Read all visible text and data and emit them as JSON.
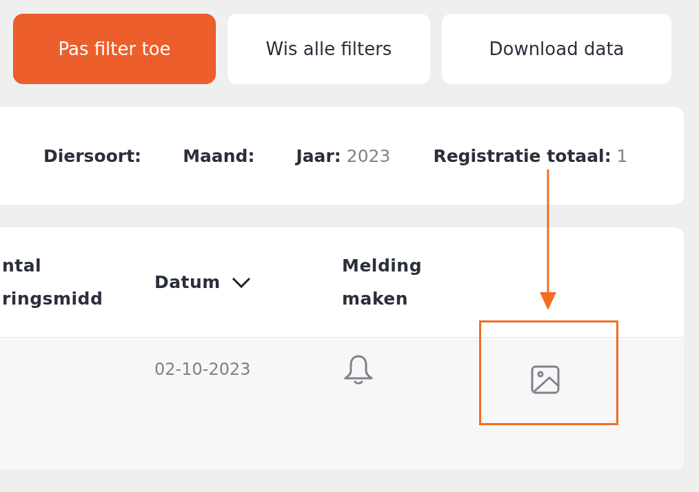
{
  "buttons": [
    {
      "label": "Pas filter toe",
      "kind": "primary"
    },
    {
      "label": "Wis alle filters",
      "kind": "secondary"
    },
    {
      "label": "Download data",
      "kind": "secondary"
    }
  ],
  "summary": [
    {
      "label": "Diersoort:"
    },
    {
      "label": "Maand:"
    },
    {
      "label": "Jaar:",
      "value": "2023"
    },
    {
      "label": "Registratie totaal:",
      "value": "1"
    }
  ],
  "table": {
    "columns": [
      {
        "label": "ntal\nringsmidd",
        "sortable": false
      },
      {
        "label": "Datum",
        "sortable": true
      },
      {
        "label": "Melding\nmaken",
        "sortable": false
      }
    ],
    "rows": [
      {
        "date": "02-10-2023"
      }
    ]
  }
}
